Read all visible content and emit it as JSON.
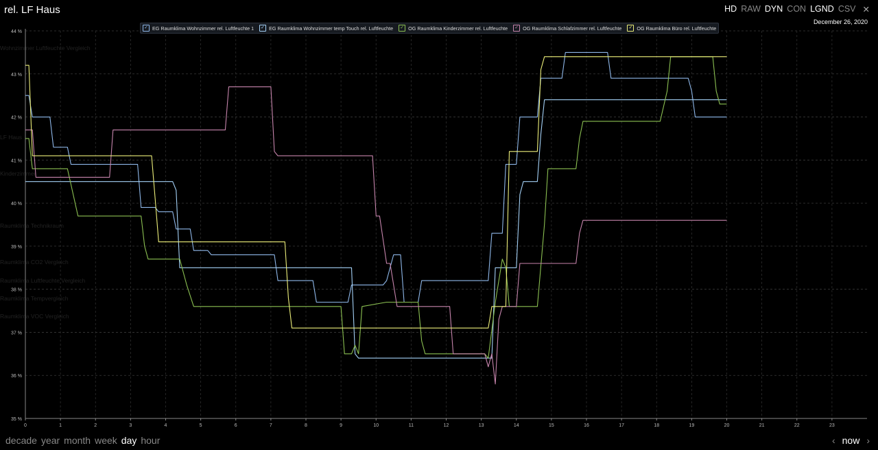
{
  "header": {
    "title": "rel. LF Haus",
    "date": "December 26, 2020",
    "modes": [
      {
        "label": "HD",
        "active": true
      },
      {
        "label": "RAW",
        "active": false
      },
      {
        "label": "DYN",
        "active": true
      },
      {
        "label": "CON",
        "active": false
      },
      {
        "label": "LGND",
        "active": true
      },
      {
        "label": "CSV",
        "active": false
      }
    ],
    "close_icon": "close-icon"
  },
  "ghost_menu": [
    "Wohnzimmer Luftfeuchte Vergleich",
    "LF Haus",
    "Kinderzimmer",
    "Raumklima Technikraum",
    "Raumklima CO2 Vergleich",
    "Raumklima Luftfeuchte Vergleich",
    "Raumklima Tempvergleich",
    "Raumklima VOC Vergleich"
  ],
  "footer": {
    "ranges": [
      {
        "label": "decade",
        "active": false
      },
      {
        "label": "year",
        "active": false
      },
      {
        "label": "month",
        "active": false
      },
      {
        "label": "week",
        "active": false
      },
      {
        "label": "day",
        "active": true
      },
      {
        "label": "hour",
        "active": false
      }
    ],
    "now_label": "now",
    "prev_icon": "chevron-left-icon",
    "next_icon": "chevron-right-icon"
  },
  "chart_data": {
    "type": "line",
    "title": "rel. LF Haus",
    "xlabel": "",
    "ylabel": "",
    "xlim": [
      0,
      24
    ],
    "ylim": [
      35,
      44
    ],
    "x_ticks": [
      "0",
      "1",
      "2",
      "3",
      "4",
      "5",
      "6",
      "7",
      "8",
      "9",
      "10",
      "11",
      "12",
      "13",
      "14",
      "15",
      "16",
      "17",
      "18",
      "19",
      "20",
      "21",
      "22",
      "23"
    ],
    "y_ticks": [
      "35 %",
      "36 %",
      "37 %",
      "38 %",
      "39 %",
      "40 %",
      "41 %",
      "42 %",
      "43 %",
      "44 %"
    ],
    "grid": true,
    "legend_position": "top-left",
    "series": [
      {
        "name": "EG Raumklima Wohnzimmer rel. Luftfeuchte 1",
        "color": "#8fb8ea",
        "x": [
          0,
          0.1,
          0.2,
          0.7,
          0.8,
          1.2,
          1.3,
          3.2,
          3.3,
          3.7,
          3.8,
          4.2,
          4.3,
          4.7,
          4.8,
          5.2,
          5.3,
          7.1,
          7.2,
          8.2,
          8.3,
          9.2,
          9.3,
          10.2,
          10.3,
          10.5,
          10.7,
          10.8,
          11.2,
          11.3,
          13.2,
          13.3,
          13.6,
          13.7,
          14.0,
          14.1,
          14.6,
          14.7,
          15.3,
          15.4,
          16.6,
          16.7,
          18.9,
          19.0,
          19.1,
          20
        ],
        "y": [
          42.5,
          42.5,
          42.0,
          42.0,
          41.3,
          41.3,
          40.9,
          40.9,
          39.9,
          39.9,
          39.8,
          39.8,
          39.4,
          39.4,
          38.9,
          38.9,
          38.8,
          38.8,
          38.2,
          38.2,
          37.7,
          37.7,
          38.1,
          38.1,
          38.2,
          38.8,
          38.8,
          37.7,
          37.7,
          38.2,
          38.2,
          39.3,
          39.3,
          40.9,
          40.9,
          42.0,
          42.0,
          42.9,
          42.9,
          43.5,
          43.5,
          42.9,
          42.9,
          42.6,
          42.0,
          42.0
        ]
      },
      {
        "name": "EG Raumklima Wohnzimmer temp Touch rel. Luftfeuchte",
        "color": "#a5d2f8",
        "x": [
          0,
          4.2,
          4.3,
          4.4,
          9.3,
          9.4,
          9.5,
          13.3,
          13.4,
          14.0,
          14.1,
          14.2,
          14.6,
          14.7,
          14.8,
          20
        ],
        "y": [
          40.5,
          40.5,
          40.3,
          38.5,
          38.5,
          36.5,
          36.4,
          36.4,
          38.5,
          38.5,
          40.2,
          40.5,
          40.5,
          41.6,
          42.4,
          42.4
        ]
      },
      {
        "name": "OG Raumklima Kinderzimmer rel. Luftfeuchte",
        "color": "#8cc152",
        "x": [
          0,
          0.1,
          0.2,
          1.2,
          1.5,
          3.3,
          3.4,
          3.5,
          4.4,
          4.6,
          4.8,
          9.0,
          9.1,
          9.3,
          9.4,
          9.5,
          9.6,
          10.3,
          11.2,
          11.3,
          11.4,
          13.1,
          13.2,
          13.4,
          13.6,
          13.7,
          13.8,
          14.6,
          14.8,
          14.9,
          15.7,
          15.8,
          15.9,
          18.1,
          18.3,
          18.4,
          19.6,
          19.7,
          19.8,
          20
        ],
        "y": [
          41.5,
          41.5,
          40.8,
          40.8,
          39.7,
          39.7,
          39.0,
          38.7,
          38.7,
          38.1,
          37.6,
          37.6,
          36.5,
          36.5,
          36.7,
          36.5,
          37.6,
          37.7,
          37.7,
          36.8,
          36.5,
          36.5,
          36.4,
          37.7,
          38.7,
          38.5,
          37.6,
          37.6,
          39.5,
          40.8,
          40.8,
          41.5,
          41.9,
          41.9,
          42.6,
          43.4,
          43.4,
          42.6,
          42.3,
          42.3
        ]
      },
      {
        "name": "OG Raumklima Schlafzimmer rel. Luftfeuchte",
        "color": "#c785ad",
        "x": [
          0,
          0.2,
          0.3,
          2.4,
          2.5,
          5.7,
          5.8,
          7.0,
          7.1,
          7.2,
          9.9,
          10.0,
          10.1,
          10.3,
          10.4,
          10.6,
          10.7,
          12.1,
          12.2,
          13.1,
          13.2,
          13.3,
          13.4,
          13.5,
          13.6,
          14.0,
          14.1,
          15.7,
          15.8,
          15.9,
          20
        ],
        "y": [
          41.7,
          41.7,
          40.6,
          40.6,
          41.7,
          41.7,
          42.7,
          42.7,
          41.2,
          41.1,
          41.1,
          39.7,
          39.7,
          38.6,
          38.6,
          37.6,
          37.6,
          37.6,
          36.5,
          36.5,
          36.2,
          36.5,
          35.8,
          37.3,
          37.6,
          37.6,
          38.6,
          38.6,
          39.3,
          39.6,
          39.6
        ]
      },
      {
        "name": "OG Raumklima Büro rel. Luftfeuchte",
        "color": "#eef07a",
        "x": [
          0,
          0.1,
          0.2,
          3.6,
          3.7,
          3.8,
          7.4,
          7.5,
          7.6,
          13.2,
          13.3,
          13.7,
          13.8,
          14.6,
          14.7,
          14.8,
          20
        ],
        "y": [
          43.2,
          43.2,
          41.1,
          41.1,
          40.1,
          39.1,
          39.1,
          37.8,
          37.1,
          37.1,
          37.6,
          37.6,
          41.2,
          41.2,
          43.1,
          43.4,
          43.4
        ]
      }
    ]
  }
}
